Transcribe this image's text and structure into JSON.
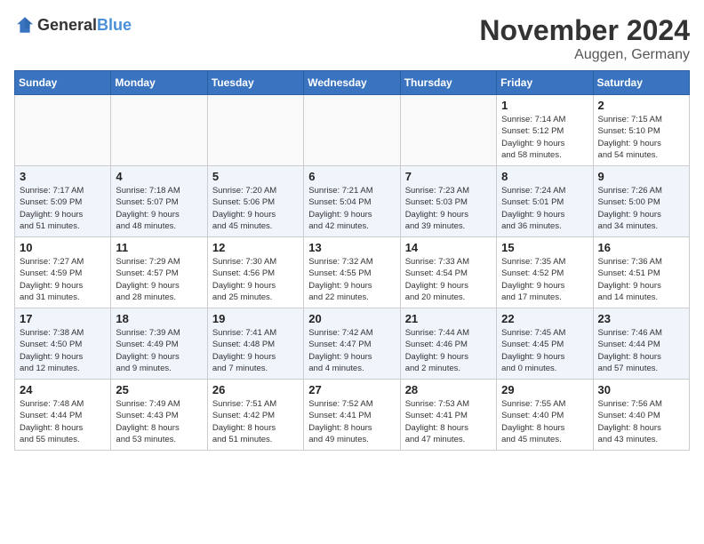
{
  "header": {
    "logo_general": "General",
    "logo_blue": "Blue",
    "month_title": "November 2024",
    "location": "Auggen, Germany"
  },
  "weekdays": [
    "Sunday",
    "Monday",
    "Tuesday",
    "Wednesday",
    "Thursday",
    "Friday",
    "Saturday"
  ],
  "weeks": [
    [
      {
        "day": "",
        "detail": ""
      },
      {
        "day": "",
        "detail": ""
      },
      {
        "day": "",
        "detail": ""
      },
      {
        "day": "",
        "detail": ""
      },
      {
        "day": "",
        "detail": ""
      },
      {
        "day": "1",
        "detail": "Sunrise: 7:14 AM\nSunset: 5:12 PM\nDaylight: 9 hours\nand 58 minutes."
      },
      {
        "day": "2",
        "detail": "Sunrise: 7:15 AM\nSunset: 5:10 PM\nDaylight: 9 hours\nand 54 minutes."
      }
    ],
    [
      {
        "day": "3",
        "detail": "Sunrise: 7:17 AM\nSunset: 5:09 PM\nDaylight: 9 hours\nand 51 minutes."
      },
      {
        "day": "4",
        "detail": "Sunrise: 7:18 AM\nSunset: 5:07 PM\nDaylight: 9 hours\nand 48 minutes."
      },
      {
        "day": "5",
        "detail": "Sunrise: 7:20 AM\nSunset: 5:06 PM\nDaylight: 9 hours\nand 45 minutes."
      },
      {
        "day": "6",
        "detail": "Sunrise: 7:21 AM\nSunset: 5:04 PM\nDaylight: 9 hours\nand 42 minutes."
      },
      {
        "day": "7",
        "detail": "Sunrise: 7:23 AM\nSunset: 5:03 PM\nDaylight: 9 hours\nand 39 minutes."
      },
      {
        "day": "8",
        "detail": "Sunrise: 7:24 AM\nSunset: 5:01 PM\nDaylight: 9 hours\nand 36 minutes."
      },
      {
        "day": "9",
        "detail": "Sunrise: 7:26 AM\nSunset: 5:00 PM\nDaylight: 9 hours\nand 34 minutes."
      }
    ],
    [
      {
        "day": "10",
        "detail": "Sunrise: 7:27 AM\nSunset: 4:59 PM\nDaylight: 9 hours\nand 31 minutes."
      },
      {
        "day": "11",
        "detail": "Sunrise: 7:29 AM\nSunset: 4:57 PM\nDaylight: 9 hours\nand 28 minutes."
      },
      {
        "day": "12",
        "detail": "Sunrise: 7:30 AM\nSunset: 4:56 PM\nDaylight: 9 hours\nand 25 minutes."
      },
      {
        "day": "13",
        "detail": "Sunrise: 7:32 AM\nSunset: 4:55 PM\nDaylight: 9 hours\nand 22 minutes."
      },
      {
        "day": "14",
        "detail": "Sunrise: 7:33 AM\nSunset: 4:54 PM\nDaylight: 9 hours\nand 20 minutes."
      },
      {
        "day": "15",
        "detail": "Sunrise: 7:35 AM\nSunset: 4:52 PM\nDaylight: 9 hours\nand 17 minutes."
      },
      {
        "day": "16",
        "detail": "Sunrise: 7:36 AM\nSunset: 4:51 PM\nDaylight: 9 hours\nand 14 minutes."
      }
    ],
    [
      {
        "day": "17",
        "detail": "Sunrise: 7:38 AM\nSunset: 4:50 PM\nDaylight: 9 hours\nand 12 minutes."
      },
      {
        "day": "18",
        "detail": "Sunrise: 7:39 AM\nSunset: 4:49 PM\nDaylight: 9 hours\nand 9 minutes."
      },
      {
        "day": "19",
        "detail": "Sunrise: 7:41 AM\nSunset: 4:48 PM\nDaylight: 9 hours\nand 7 minutes."
      },
      {
        "day": "20",
        "detail": "Sunrise: 7:42 AM\nSunset: 4:47 PM\nDaylight: 9 hours\nand 4 minutes."
      },
      {
        "day": "21",
        "detail": "Sunrise: 7:44 AM\nSunset: 4:46 PM\nDaylight: 9 hours\nand 2 minutes."
      },
      {
        "day": "22",
        "detail": "Sunrise: 7:45 AM\nSunset: 4:45 PM\nDaylight: 9 hours\nand 0 minutes."
      },
      {
        "day": "23",
        "detail": "Sunrise: 7:46 AM\nSunset: 4:44 PM\nDaylight: 8 hours\nand 57 minutes."
      }
    ],
    [
      {
        "day": "24",
        "detail": "Sunrise: 7:48 AM\nSunset: 4:44 PM\nDaylight: 8 hours\nand 55 minutes."
      },
      {
        "day": "25",
        "detail": "Sunrise: 7:49 AM\nSunset: 4:43 PM\nDaylight: 8 hours\nand 53 minutes."
      },
      {
        "day": "26",
        "detail": "Sunrise: 7:51 AM\nSunset: 4:42 PM\nDaylight: 8 hours\nand 51 minutes."
      },
      {
        "day": "27",
        "detail": "Sunrise: 7:52 AM\nSunset: 4:41 PM\nDaylight: 8 hours\nand 49 minutes."
      },
      {
        "day": "28",
        "detail": "Sunrise: 7:53 AM\nSunset: 4:41 PM\nDaylight: 8 hours\nand 47 minutes."
      },
      {
        "day": "29",
        "detail": "Sunrise: 7:55 AM\nSunset: 4:40 PM\nDaylight: 8 hours\nand 45 minutes."
      },
      {
        "day": "30",
        "detail": "Sunrise: 7:56 AM\nSunset: 4:40 PM\nDaylight: 8 hours\nand 43 minutes."
      }
    ]
  ]
}
